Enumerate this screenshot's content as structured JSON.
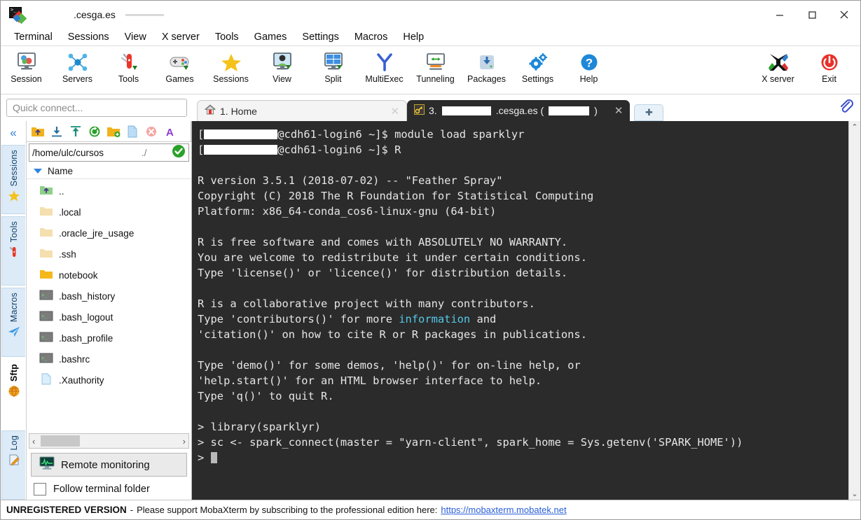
{
  "window": {
    "title_suffix": ".cesga.es",
    "icon": "mobaxterm-logo-icon",
    "minimize": "–",
    "maximize": "□",
    "close": "✕"
  },
  "menubar": {
    "items": [
      "Terminal",
      "Sessions",
      "View",
      "X server",
      "Tools",
      "Games",
      "Settings",
      "Macros",
      "Help"
    ]
  },
  "toolbar": {
    "buttons": [
      {
        "label": "Session",
        "icon": "session-icon"
      },
      {
        "label": "Servers",
        "icon": "servers-icon"
      },
      {
        "label": "Tools",
        "icon": "tools-icon"
      },
      {
        "label": "Games",
        "icon": "games-icon"
      },
      {
        "label": "Sessions",
        "icon": "sessions-star-icon"
      },
      {
        "label": "View",
        "icon": "view-icon"
      },
      {
        "label": "Split",
        "icon": "split-icon"
      },
      {
        "label": "MultiExec",
        "icon": "multiexec-icon"
      },
      {
        "label": "Tunneling",
        "icon": "tunneling-icon"
      },
      {
        "label": "Packages",
        "icon": "packages-icon"
      },
      {
        "label": "Settings",
        "icon": "settings-gear-icon"
      },
      {
        "label": "Help",
        "icon": "help-icon"
      }
    ],
    "right_buttons": [
      {
        "label": "X server",
        "icon": "xserver-icon"
      },
      {
        "label": "Exit",
        "icon": "exit-power-icon"
      }
    ]
  },
  "quick_connect": {
    "placeholder": "Quick connect..."
  },
  "tabs": {
    "items": [
      {
        "label": "1. Home",
        "icon": "home-icon",
        "active": false,
        "close": "✕"
      },
      {
        "label_prefix": "3.",
        "label_suffix": ".cesga.es (",
        "label_end": ")",
        "icon": "key-icon",
        "active": true,
        "close": "✕"
      }
    ],
    "new_tab_label": "✚",
    "attach_icon": "paperclip-icon"
  },
  "rail": {
    "collapse_icon": "collapse-chevrons-icon",
    "items": [
      {
        "label": "Sessions",
        "icon": "star-icon"
      },
      {
        "label": "Tools",
        "icon": "swiss-knife-icon"
      },
      {
        "label": "Macros",
        "icon": "paper-plane-icon"
      },
      {
        "label": "Sftp",
        "icon": "globe-icon",
        "selected": true
      },
      {
        "label": "Log",
        "icon": "pencil-note-icon"
      }
    ]
  },
  "sftp": {
    "toolbar_icons": [
      "parent-folder-icon",
      "download-icon",
      "upload-icon",
      "refresh-icon",
      "new-folder-icon",
      "new-file-icon",
      "delete-icon",
      "text-mode-icon"
    ],
    "path": "/home/ulc/cursos",
    "path_tail": "./",
    "path_ok_icon": "check-circle-icon",
    "column_header": "Name",
    "sort_icon": "sort-descending-icon",
    "files": [
      {
        "name": "..",
        "type": "parent"
      },
      {
        "name": ".local",
        "type": "folder"
      },
      {
        "name": ".oracle_jre_usage",
        "type": "folder"
      },
      {
        "name": ".ssh",
        "type": "folder"
      },
      {
        "name": "notebook",
        "type": "folder-highlight"
      },
      {
        "name": ".bash_history",
        "type": "script"
      },
      {
        "name": ".bash_logout",
        "type": "script"
      },
      {
        "name": ".bash_profile",
        "type": "script"
      },
      {
        "name": ".bashrc",
        "type": "script"
      },
      {
        "name": ".Xauthority",
        "type": "file"
      }
    ],
    "scroll_left": "‹",
    "scroll_right": "›",
    "remote_monitoring_label": "Remote monitoring",
    "remote_monitoring_icon": "monitor-graph-icon",
    "follow_label": "Follow terminal folder",
    "follow_checked": false
  },
  "terminal": {
    "prompt_host": "@cdh61-login6 ~]$ ",
    "line1_cmd": "module load sparklyr",
    "line2_cmd": "R",
    "lines": [
      "R version 3.5.1 (2018-07-02) -- \"Feather Spray\"",
      "Copyright (C) 2018 The R Foundation for Statistical Computing",
      "Platform: x86_64-conda_cos6-linux-gnu (64-bit)",
      "",
      "R is free software and comes with ABSOLUTELY NO WARRANTY.",
      "You are welcome to redistribute it under certain conditions.",
      "Type 'license()' or 'licence()' for distribution details.",
      ""
    ],
    "collab_line": "R is a collaborative project with many contributors.",
    "contrib_pre": "Type 'contributors()' for more ",
    "contrib_link": "information",
    "contrib_post": " and",
    "citation_line": "'citation()' on how to cite R or R packages in publications.",
    "help_lines": [
      "Type 'demo()' for some demos, 'help()' for on-line help, or",
      "'help.start()' for an HTML browser interface to help.",
      "Type 'q()' to quit R.",
      ""
    ],
    "r_prompt": "> ",
    "r_cmd1": "library(sparklyr)",
    "r_cmd2": "sc <- spark_connect(master = \"yarn-client\", spark_home = Sys.getenv('SPARK_HOME'))",
    "scroll_up": "⌃",
    "scroll_down": "⌄"
  },
  "status": {
    "bold_text": "UNREGISTERED VERSION",
    "dash": "-",
    "message": "Please support MobaXterm by subscribing to the professional edition here:",
    "link": "https://mobaxterm.mobatek.net"
  },
  "colors": {
    "accent_blue": "#2f7fd1",
    "terminal_bg": "#2b2b2b",
    "terminal_fg": "#e6e6e6",
    "link_cyan": "#56c8e8",
    "status_link": "#2a5fd8"
  }
}
